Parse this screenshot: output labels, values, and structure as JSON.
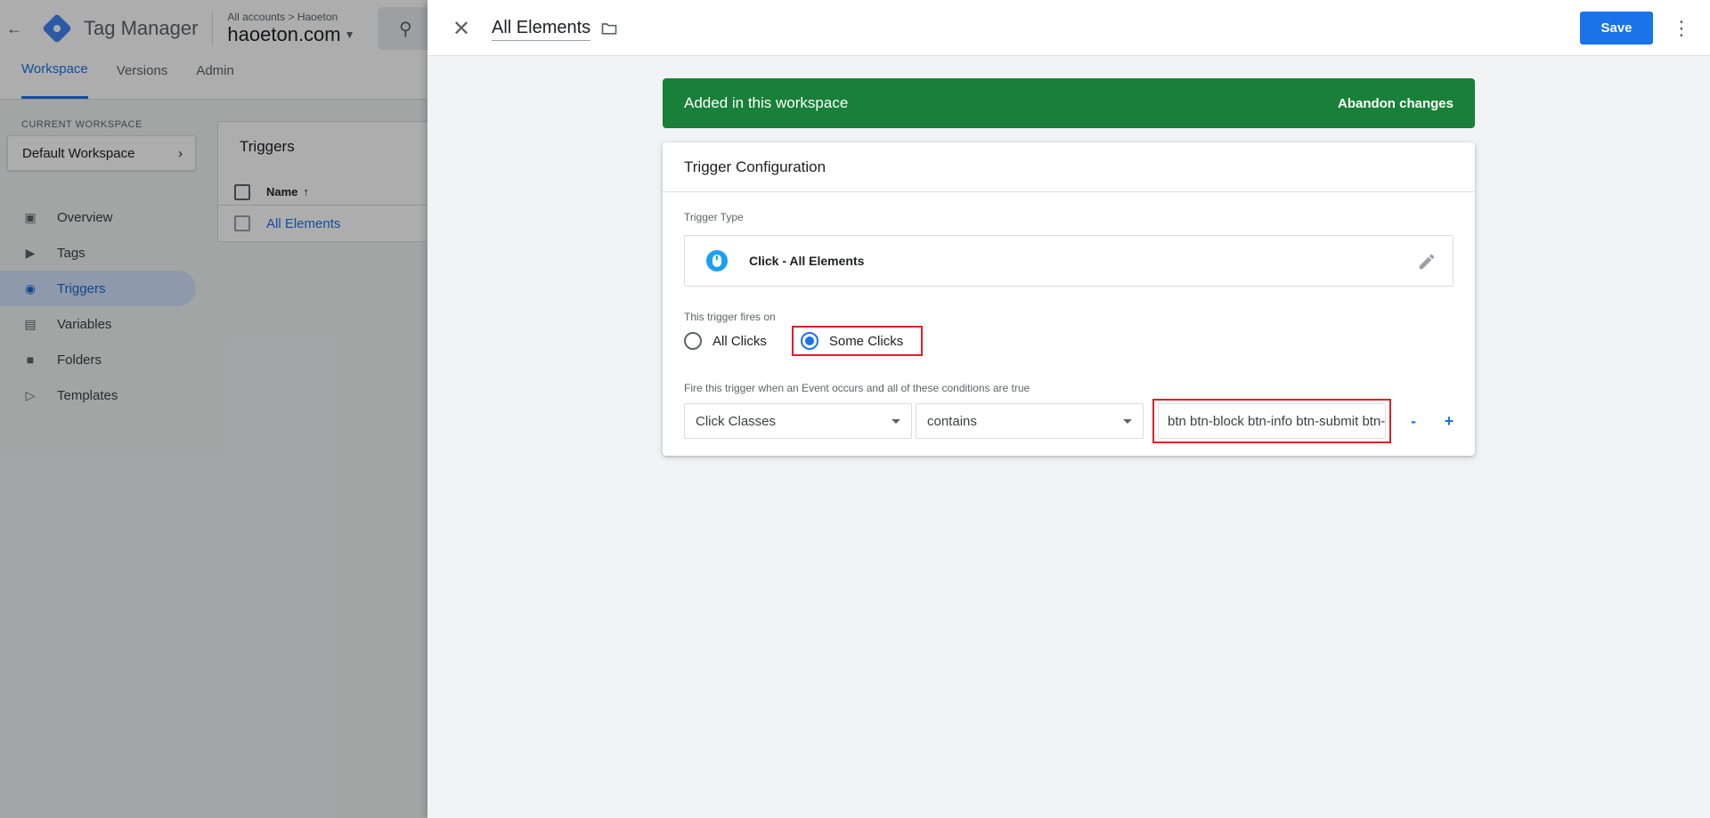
{
  "app": {
    "product_name": "Tag Manager",
    "account_breadcrumb_root": "All accounts",
    "account_breadcrumb_account": "Haoeton",
    "container_name": "haoeton.com",
    "tabs": [
      {
        "label": "Workspace"
      },
      {
        "label": "Versions"
      },
      {
        "label": "Admin"
      }
    ],
    "current_workspace_label": "CURRENT WORKSPACE",
    "current_workspace_value": "Default Workspace",
    "nav": [
      {
        "label": "Overview",
        "icon": "briefcase-icon"
      },
      {
        "label": "Tags",
        "icon": "tag-icon"
      },
      {
        "label": "Triggers",
        "icon": "trigger-icon"
      },
      {
        "label": "Variables",
        "icon": "variables-icon"
      },
      {
        "label": "Folders",
        "icon": "folder-icon"
      },
      {
        "label": "Templates",
        "icon": "template-icon"
      }
    ],
    "triggers_list": {
      "title": "Triggers",
      "column_name": "Name",
      "rows": [
        {
          "name": "All Elements"
        }
      ]
    }
  },
  "panel": {
    "title": "All Elements",
    "save_label": "Save",
    "banner_text": "Added in this workspace",
    "banner_action": "Abandon changes",
    "config_title": "Trigger Configuration",
    "trigger_type_label": "Trigger Type",
    "trigger_type_value": "Click - All Elements",
    "fires_on_label": "This trigger fires on",
    "option_all": "All Clicks",
    "option_some": "Some Clicks",
    "selected_option": "Some Clicks",
    "condition_label": "Fire this trigger when an Event occurs and all of these conditions are true",
    "condition": {
      "variable": "Click Classes",
      "operator": "contains",
      "value": "btn btn-block btn-info btn-submit btn-lg"
    },
    "remove_label": "-",
    "add_label": "+"
  },
  "colors": {
    "accent": "#1a73e8",
    "banner_green": "#188038",
    "highlight_red": "#e01e28"
  }
}
